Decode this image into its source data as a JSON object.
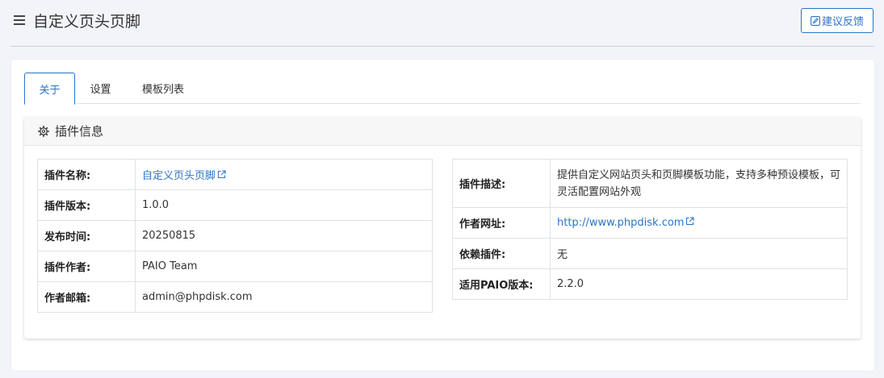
{
  "header": {
    "title": "自定义页头页脚",
    "feedback_label": "建议反馈"
  },
  "tabs": [
    {
      "label": "关于",
      "active": true
    },
    {
      "label": "设置",
      "active": false
    },
    {
      "label": "模板列表",
      "active": false
    }
  ],
  "info_card": {
    "title": "插件信息"
  },
  "left_info": [
    {
      "key": "插件名称:",
      "value": "自定义页头页脚"
    },
    {
      "key": "插件版本:",
      "value": "1.0.0"
    },
    {
      "key": "发布时间:",
      "value": "20250815"
    },
    {
      "key": "插件作者:",
      "value": "PAIO Team"
    },
    {
      "key": "作者邮箱:",
      "value": "admin@phpdisk.com"
    }
  ],
  "right_info": [
    {
      "key": "插件描述:",
      "value": "提供自定义网站页头和页脚模板功能，支持多种预设模板，可灵活配置网站外观"
    },
    {
      "key": "作者网址:",
      "value": "http://www.phpdisk.com"
    },
    {
      "key": "依赖插件:",
      "value": "无"
    },
    {
      "key": "适用PAIO版本:",
      "value": "2.2.0"
    }
  ],
  "colors": {
    "accent": "#2a74c9",
    "background": "#f3f4f9"
  },
  "icons": [
    "menu-icon",
    "edit-icon",
    "gear-icon",
    "external-link-icon"
  ]
}
